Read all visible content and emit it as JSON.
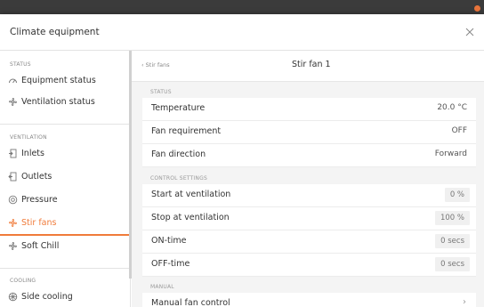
{
  "dialog": {
    "title": "Climate equipment"
  },
  "sidebar": {
    "sections": [
      {
        "heading": "STATUS"
      },
      {
        "heading": "VENTILATION"
      },
      {
        "heading": "COOLING"
      }
    ],
    "items": [
      {
        "label": "Equipment status",
        "icon": "gauge-icon"
      },
      {
        "label": "Ventilation status",
        "icon": "fan-status-icon"
      },
      {
        "label": "Inlets",
        "icon": "inlet-icon"
      },
      {
        "label": "Outlets",
        "icon": "outlet-icon"
      },
      {
        "label": "Pressure",
        "icon": "pressure-icon"
      },
      {
        "label": "Stir fans",
        "icon": "stir-fan-icon",
        "active": true
      },
      {
        "label": "Soft Chill",
        "icon": "soft-chill-icon"
      },
      {
        "label": "Side cooling",
        "icon": "side-cooling-icon"
      }
    ]
  },
  "main": {
    "back_label": "‹ Stir fans",
    "title": "Stir fan 1",
    "status": {
      "heading": "STATUS",
      "rows": [
        {
          "label": "Temperature",
          "value": "20.0 °C"
        },
        {
          "label": "Fan requirement",
          "value": "OFF"
        },
        {
          "label": "Fan direction",
          "value": "Forward"
        }
      ]
    },
    "control": {
      "heading": "CONTROL SETTINGS",
      "rows": [
        {
          "label": "Start at ventilation",
          "value": "0 %"
        },
        {
          "label": "Stop at ventilation",
          "value": "100 %"
        },
        {
          "label": "ON-time",
          "value": "0 secs"
        },
        {
          "label": "OFF-time",
          "value": "0 secs"
        }
      ]
    },
    "manual": {
      "heading": "MANUAL",
      "rows": [
        {
          "label": "Manual fan control",
          "value": "›"
        }
      ]
    }
  },
  "colors": {
    "accent": "#f07b3a",
    "background": "#f4f4f4"
  }
}
